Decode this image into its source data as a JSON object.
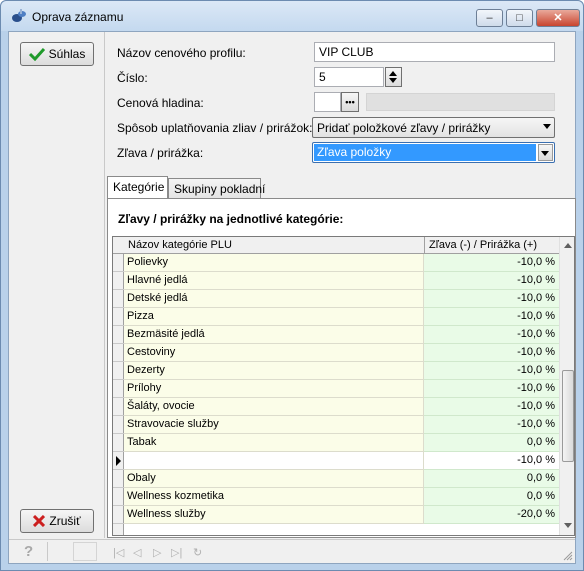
{
  "window": {
    "title": "Oprava záznamu",
    "minimize": "–",
    "maximize": "□",
    "close": "✕"
  },
  "buttons": {
    "confirm": "Súhlas",
    "cancel": "Zrušiť"
  },
  "form": {
    "profile_name_label": "Názov cenového profilu:",
    "profile_name_value": "VIP CLUB",
    "number_label": "Číslo:",
    "number_value": "5",
    "price_level_label": "Cenová hladina:",
    "price_level_button": "•••",
    "method_label": "Spôsob uplatňovania zliav / prirážok:",
    "method_value": "Pridať položkové zľavy / prirážky",
    "discount_label": "Zľava / prirážka:",
    "discount_value": "Zľava položky"
  },
  "tabs": [
    "Kategórie",
    "Skupiny pokladní"
  ],
  "grid": {
    "title": "Zľavy / prirážky na jednotlivé kategórie:",
    "columns": [
      "Názov kategórie PLU",
      "Zľava (-) / Prirážka (+)"
    ],
    "rows": [
      {
        "name": "Polievky",
        "value": "-10,0 %"
      },
      {
        "name": "Hlavné jedlá",
        "value": "-10,0 %"
      },
      {
        "name": "Detské jedlá",
        "value": "-10,0 %"
      },
      {
        "name": "Pizza",
        "value": "-10,0 %"
      },
      {
        "name": "Bezmäsité jedlá",
        "value": "-10,0 %"
      },
      {
        "name": "Cestoviny",
        "value": "-10,0 %"
      },
      {
        "name": "Dezerty",
        "value": "-10,0 %"
      },
      {
        "name": "Prílohy",
        "value": "-10,0 %"
      },
      {
        "name": "Šaláty, ovocie",
        "value": "-10,0 %"
      },
      {
        "name": "Stravovacie služby",
        "value": "-10,0 %"
      },
      {
        "name": "Tabak",
        "value": "0,0 %"
      },
      {
        "name": "",
        "value": "-10,0 %"
      },
      {
        "name": "Obaly",
        "value": "0,0 %"
      },
      {
        "name": "Wellness kozmetika",
        "value": "0,0 %"
      },
      {
        "name": "Wellness služby",
        "value": "-20,0 %"
      }
    ]
  },
  "statusbar": {
    "help": "?",
    "nav": [
      "|◁",
      "◁",
      "▷",
      "▷|",
      "↻"
    ]
  }
}
